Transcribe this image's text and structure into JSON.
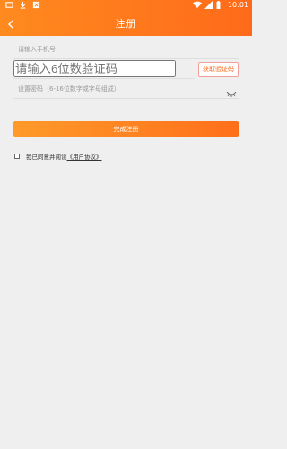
{
  "statusbar": {
    "time": "10:01"
  },
  "navbar": {
    "title": "注册"
  },
  "form": {
    "phone_placeholder": "请输入手机号",
    "code_placeholder": "请输入6位数验证码",
    "get_code_label": "获取验证码",
    "password_placeholder": "设置密码（6-16位数字或字母组成）"
  },
  "submit_label": "完成注册",
  "agreement": {
    "prefix": "我已同意并阅读",
    "link_text": "《用户协议》"
  },
  "colors": {
    "accent": "#ff7a1e",
    "background": "#efefef"
  }
}
